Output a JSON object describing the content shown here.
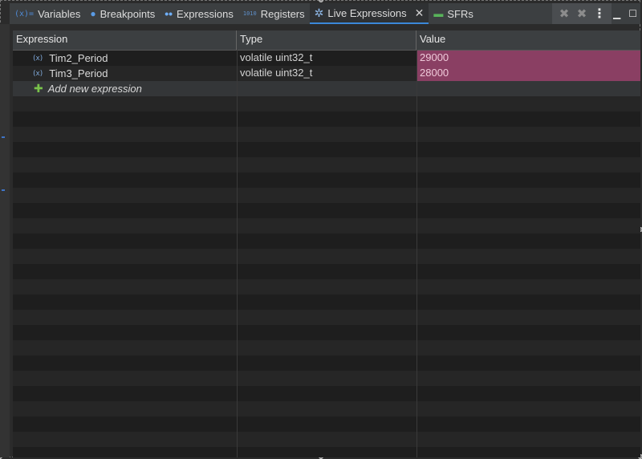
{
  "tabs": [
    {
      "icon": "variables-icon",
      "glyph": "(x)=",
      "label": "Variables"
    },
    {
      "icon": "breakpoints-icon",
      "glyph": "●",
      "label": "Breakpoints"
    },
    {
      "icon": "expressions-icon",
      "glyph": "••",
      "label": "Expressions"
    },
    {
      "icon": "registers-icon",
      "glyph": "1010",
      "label": "Registers"
    },
    {
      "icon": "live-expressions-icon",
      "glyph": "✲",
      "label": "Live Expressions",
      "active": true
    },
    {
      "icon": "sfrs-icon",
      "glyph": "▬",
      "label": "SFRs"
    }
  ],
  "toolbar": {
    "remove_icon": "remove-icon",
    "remove_all_icon": "remove-all-icon",
    "view_menu_icon": "view-menu-icon",
    "minimize_icon": "minimize-icon",
    "maximize_icon": "maximize-icon"
  },
  "table": {
    "columns": [
      "Expression",
      "Type",
      "Value"
    ],
    "rows": [
      {
        "expression": "Tim2_Period",
        "type": "volatile uint32_t",
        "value": "29000"
      },
      {
        "expression": "Tim3_Period",
        "type": "volatile uint32_t",
        "value": "28000"
      }
    ],
    "add_label": "Add new expression"
  },
  "colors": {
    "changed_value_bg": "#8a3f63",
    "active_tab_underline": "#3b88d9",
    "add_icon": "#79c24a"
  }
}
